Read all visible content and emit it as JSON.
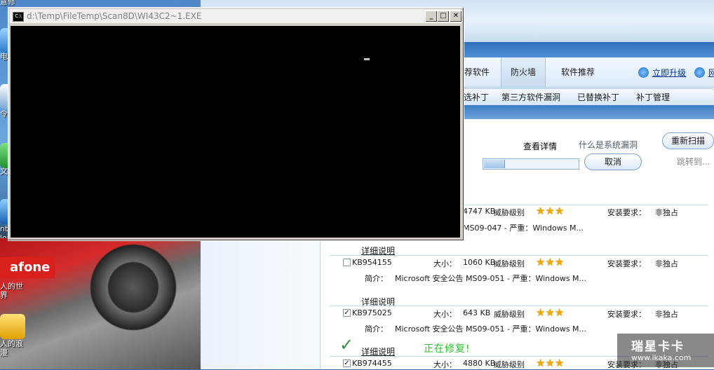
{
  "desktop": {
    "icon_labels": [
      "意修",
      "电",
      "令",
      "文",
      "nterr\nlor",
      "人的世\n界",
      "人的浪\n漫"
    ],
    "wallpaper_brand": "afone"
  },
  "console": {
    "title": "d:\\Temp\\FileTemp\\Scan8D\\WI43C2~1.EXE",
    "btn_min": "_",
    "btn_max": "□",
    "btn_close": "✕"
  },
  "app": {
    "tabs": [
      "荐软件",
      "防火墙",
      "软件推荐"
    ],
    "links": [
      "立即升级",
      "网"
    ],
    "subtabs": [
      "选补丁",
      "第三方软件漏洞",
      "已替换补丁",
      "补丁管理"
    ],
    "scan": {
      "view_details": "查看详情",
      "what_is_vuln": "什么是系统漏洞",
      "cancel": "取消",
      "rescan": "重新扫描",
      "jump_to": "跳转到...",
      "progress": 0.22
    },
    "patches": [
      {
        "kb": "",
        "size_label": "",
        "size": "4747 KB",
        "threat_label": "威胁级别",
        "stars": "★★★",
        "req_label": "安装要求：",
        "req": "非独占",
        "summary_label": "",
        "summary": "MS09-047 - 严重：Windows M...",
        "detail": "详细说明",
        "checked": "",
        "partial": true
      },
      {
        "kb": "KB954155",
        "size_label": "大小：",
        "size": "1060 KB",
        "threat_label": "威胁级别",
        "stars": "★★★",
        "req_label": "安装要求：",
        "req": "非独占",
        "summary_label": "简介：",
        "summary": "Microsoft 安全公告 MS09-051 - 严重：Windows M...",
        "detail": "详细说明",
        "checked": ""
      },
      {
        "kb": "KB975025",
        "size_label": "大小：",
        "size": "643 KB",
        "threat_label": "威胁级别",
        "stars": "★★★",
        "req_label": "安装要求：",
        "req": "非独占",
        "summary_label": "简介：",
        "summary": "Microsoft 安全公告 MS09-051 - 严重：Windows M...",
        "detail": "详细说明",
        "checked": "✓"
      },
      {
        "kb": "KB974455",
        "size_label": "大小：",
        "size": "4880 KB",
        "threat_label": "威胁级别",
        "stars": "★★★",
        "req_label": "安装要求：",
        "req": "非独占",
        "summary_label": "",
        "summary": "",
        "detail": "",
        "checked": "✓"
      }
    ],
    "fixing": "正在修复!",
    "checkmark": "✓"
  },
  "watermark": {
    "line1": "瑞星卡卡",
    "line2": "www.ikaka.com"
  }
}
